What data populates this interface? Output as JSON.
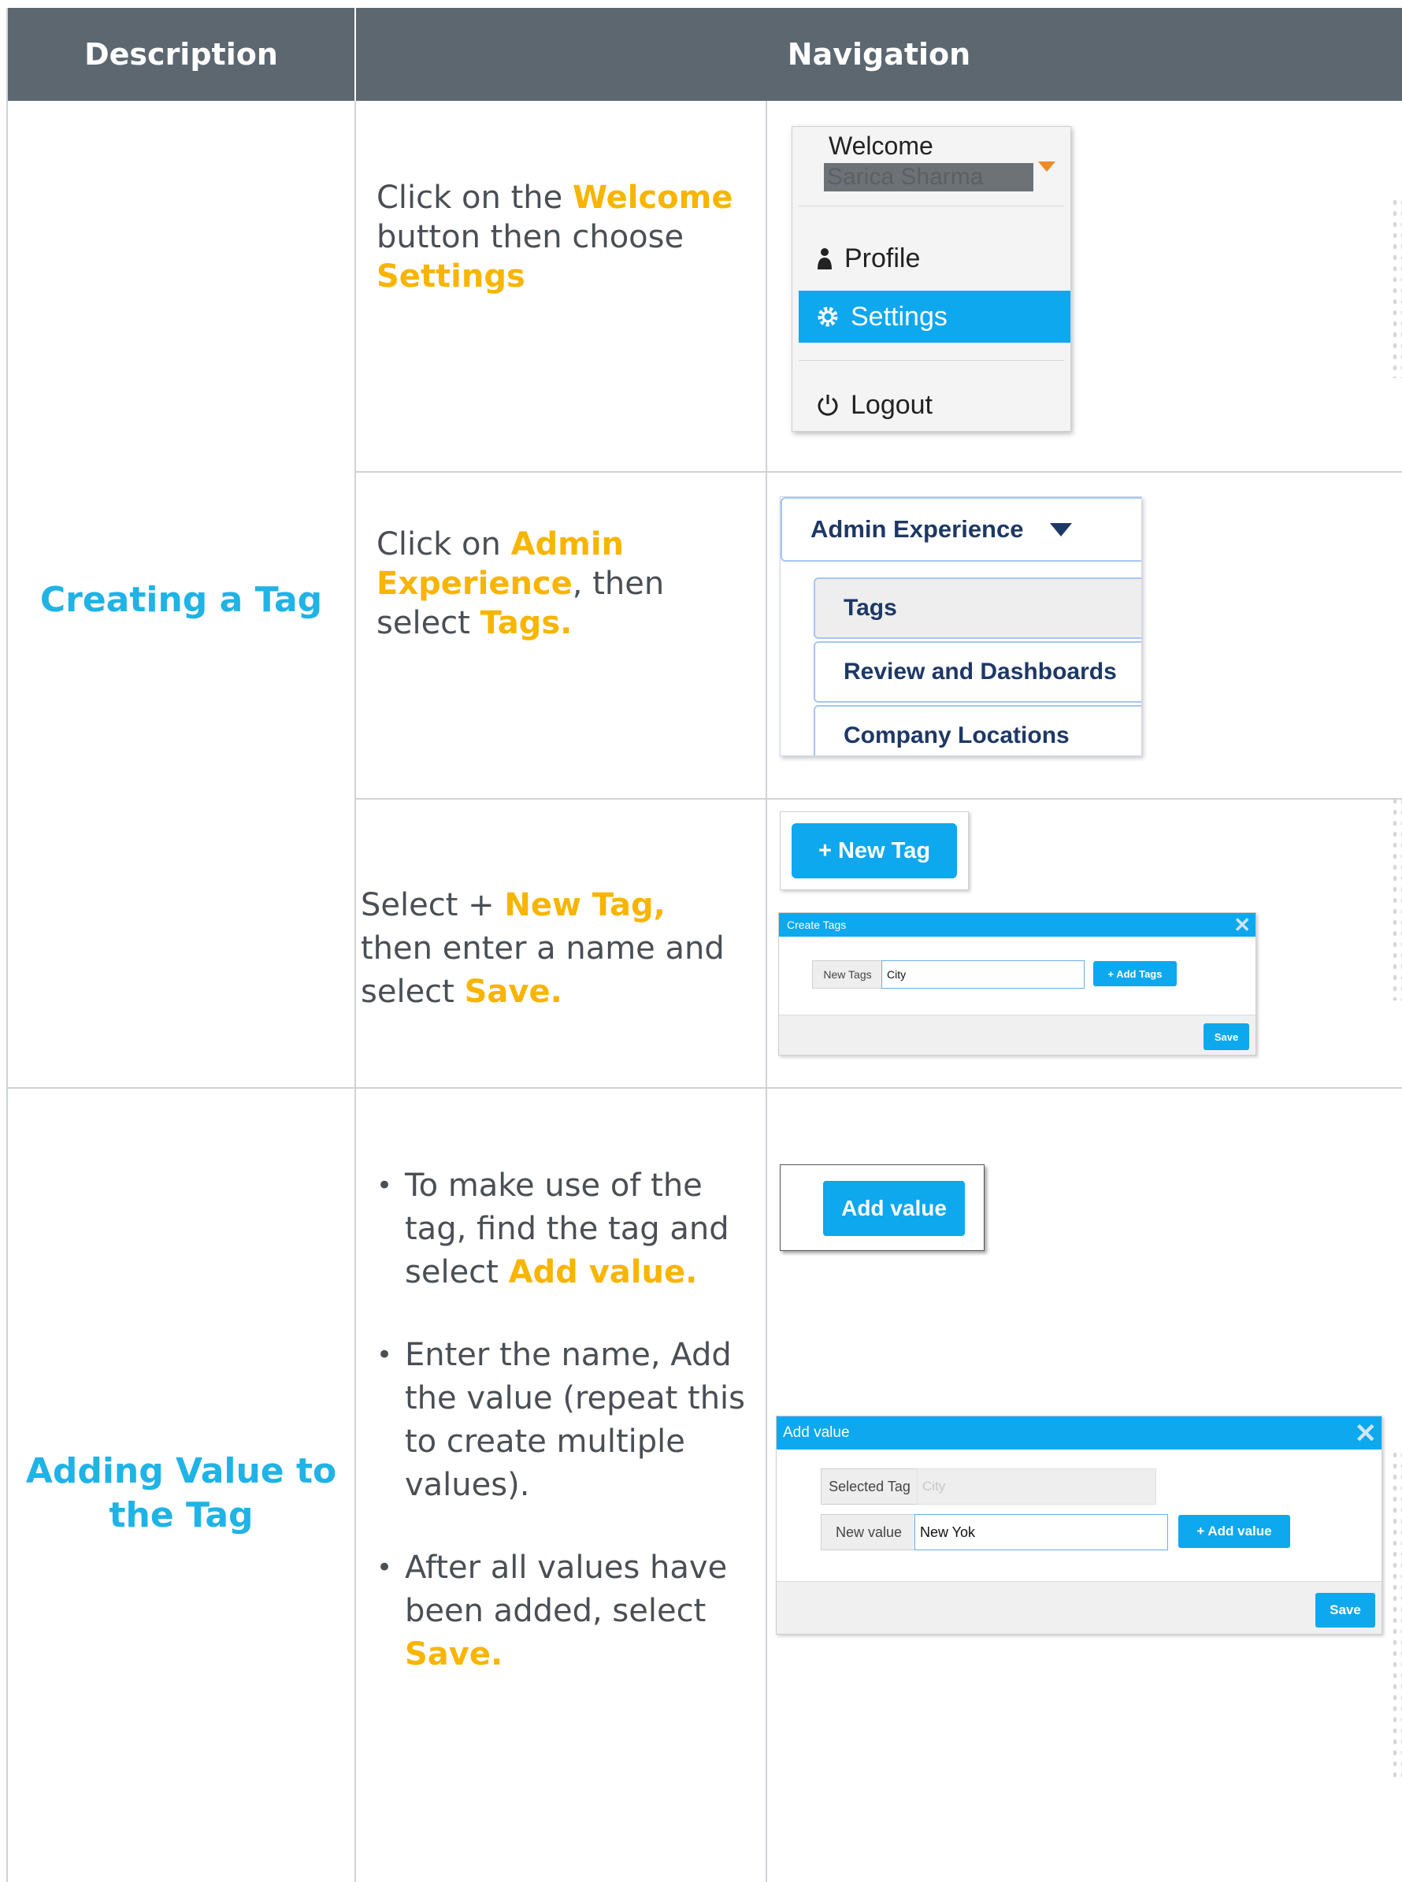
{
  "table": {
    "header": {
      "col1": "Description",
      "col2": "Navigation"
    }
  },
  "section1": {
    "title": "Creating a Tag",
    "step1": {
      "pre": "Click on the ",
      "hl1": "Welcome",
      "mid": " button then choose ",
      "hl2": "Settings"
    },
    "step2": {
      "pre": "Click on ",
      "hl1": "Admin Experience",
      "mid": ", then select ",
      "hl2": "Tags."
    },
    "step3": {
      "pre": "Select + ",
      "hl1": "New Tag,",
      "mid": "  then enter a name and select ",
      "hl2": "Save."
    }
  },
  "section2": {
    "title": "Adding Value to the Tag",
    "bullet1": {
      "pre": "To make use of the tag, find the tag and select ",
      "hl": "Add value."
    },
    "bullet2": {
      "pre": "Enter the name, Add the value (repeat this to create multiple values)."
    },
    "bullet3": {
      "pre": "After all values have been added, select ",
      "hl": "Save."
    },
    "bullet_glyph": "•"
  },
  "screenshots": {
    "welcome_menu": {
      "welcome_label": "Welcome",
      "user_name": "Sarica Sharma",
      "items": [
        "Profile",
        "Settings",
        "Logout"
      ],
      "selected_color": "#0ea8ee"
    },
    "admin_menu": {
      "title": "Admin Experience",
      "options": [
        "Tags",
        "Review and Dashboards",
        "Company Locations"
      ]
    },
    "new_tag_button": "+ New Tag",
    "create_tags_dialog": {
      "title": "Create Tags",
      "field_label": "New Tags",
      "field_value": "City",
      "add_button": "+ Add Tags",
      "save_button": "Save"
    },
    "add_value_button": "Add value",
    "add_value_dialog": {
      "title": "Add value",
      "selected_tag_label": "Selected Tag",
      "selected_tag_value": "City",
      "new_value_label": "New value",
      "new_value_value": "New Yok",
      "add_button": "+ Add value",
      "save_button": "Save"
    }
  },
  "colors": {
    "header_bg": "#5c6770",
    "section_title": "#1fb3e6",
    "highlight": "#f7b500",
    "accent": "#0ea8ee"
  }
}
